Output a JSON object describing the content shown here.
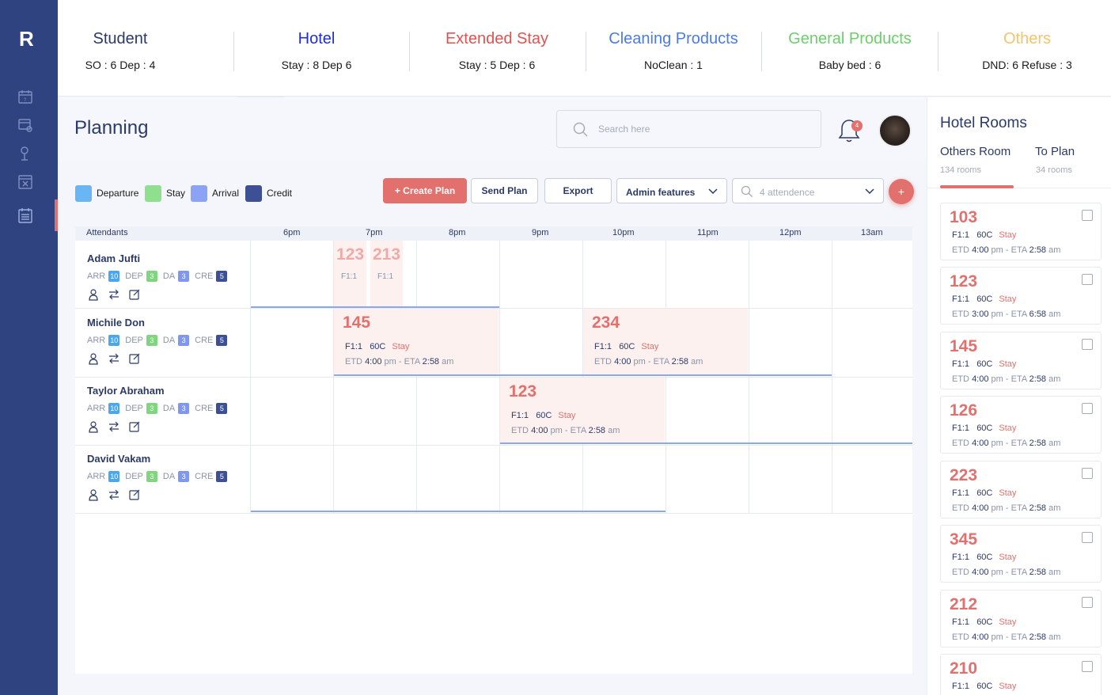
{
  "app": {
    "logo": "R"
  },
  "stats": [
    {
      "title": "Student",
      "sub": "SO : 6 Dep : 4",
      "color": "#2b3a67"
    },
    {
      "title": "Hotel",
      "sub": "Stay : 8 Dep 6",
      "color": "#1f2ddb"
    },
    {
      "title": "Extended Stay",
      "sub": "Stay : 5 Dep : 6",
      "color": "#e2524f"
    },
    {
      "title": "Cleaning Products",
      "sub": "NoClean : 1",
      "color": "#4b7be5"
    },
    {
      "title": "General Products",
      "sub": "Baby bed : 6",
      "color": "#6bcf6b"
    },
    {
      "title": "Others",
      "sub": "DND: 6 Refuse : 3",
      "color": "#f4c46a"
    }
  ],
  "header": {
    "title": "Planning",
    "search_placeholder": "Search here",
    "notifications": "4"
  },
  "legend": [
    {
      "label": "Departure",
      "color": "#6ab6f5"
    },
    {
      "label": "Stay",
      "color": "#8ee08e"
    },
    {
      "label": "Arrival",
      "color": "#8aa3f5"
    },
    {
      "label": "Credit",
      "color": "#3d4f95"
    }
  ],
  "toolbar": {
    "create": "+ Create Plan",
    "send": "Send Plan",
    "export": "Export",
    "admin": "Admin features",
    "attendance": "4 attendence",
    "add": "+"
  },
  "schedule": {
    "attendants_label": "Attendants",
    "times": [
      "6pm",
      "7pm",
      "8pm",
      "9pm",
      "10pm",
      "11pm",
      "12pm",
      "13am"
    ],
    "tag_labels": {
      "arr": "ARR",
      "dep": "DEP",
      "da": "DA",
      "cre": "CRE"
    },
    "tag_colors": {
      "arr": "#4aa6f0",
      "dep": "#7fd67f",
      "da": "#7f97f0",
      "cre": "#3d4f95"
    },
    "attendants": [
      {
        "name": "Adam Jufti",
        "arr": "10",
        "dep": "3",
        "da": "3",
        "cre": "5"
      },
      {
        "name": "Michile Don",
        "arr": "10",
        "dep": "3",
        "da": "3",
        "cre": "5"
      },
      {
        "name": "Taylor Abraham",
        "arr": "10",
        "dep": "3",
        "da": "3",
        "cre": "5"
      },
      {
        "name": "David Vakam",
        "arr": "10",
        "dep": "3",
        "da": "3",
        "cre": "5"
      }
    ],
    "mini_bookings": [
      {
        "room": "123",
        "floor": "F1:1"
      },
      {
        "room": "213",
        "floor": "F1:1"
      }
    ],
    "bookings": [
      {
        "room": "145",
        "floor": "F1:1",
        "temp": "60C",
        "status": "Stay",
        "etd_label": "ETD",
        "etd": "4:00",
        "etd_suffix": "pm - ETA",
        "eta": "2:58",
        "eta_suffix": "am"
      },
      {
        "room": "234",
        "floor": "F1:1",
        "temp": "60C",
        "status": "Stay",
        "etd_label": "ETD",
        "etd": "4:00",
        "etd_suffix": "pm - ETA",
        "eta": "2:58",
        "eta_suffix": "am"
      },
      {
        "room": "123",
        "floor": "F1:1",
        "temp": "60C",
        "status": "Stay",
        "etd_label": "ETD",
        "etd": "4:00",
        "etd_suffix": "pm - ETA",
        "eta": "2:58",
        "eta_suffix": "am"
      }
    ]
  },
  "rooms_panel": {
    "title": "Hotel Rooms",
    "tabs": [
      {
        "label": "Others Room",
        "sub": "134 rooms"
      },
      {
        "label": "To Plan",
        "sub": "34 rooms"
      }
    ],
    "rooms": [
      {
        "room": "103",
        "floor": "F1:1",
        "temp": "60C",
        "status": "Stay",
        "etd_label": "ETD",
        "etd": "4:00",
        "etd_suffix": "pm - ETA",
        "eta": "2:58",
        "eta_suffix": "am"
      },
      {
        "room": "123",
        "floor": "F1:1",
        "temp": "60C",
        "status": "Stay",
        "etd_label": "ETD",
        "etd": "3:00",
        "etd_suffix": "pm - ETA",
        "eta": "6:58",
        "eta_suffix": "am"
      },
      {
        "room": "145",
        "floor": "F1:1",
        "temp": "60C",
        "status": "Stay",
        "etd_label": "ETD",
        "etd": "4:00",
        "etd_suffix": "pm - ETA",
        "eta": "2:58",
        "eta_suffix": "am"
      },
      {
        "room": "126",
        "floor": "F1:1",
        "temp": "60C",
        "status": "Stay",
        "etd_label": "ETD",
        "etd": "4:00",
        "etd_suffix": "pm - ETA",
        "eta": "2:58",
        "eta_suffix": "am"
      },
      {
        "room": "223",
        "floor": "F1:1",
        "temp": "60C",
        "status": "Stay",
        "etd_label": "ETD",
        "etd": "4:00",
        "etd_suffix": "pm - ETA",
        "eta": "2:58",
        "eta_suffix": "am"
      },
      {
        "room": "345",
        "floor": "F1:1",
        "temp": "60C",
        "status": "Stay",
        "etd_label": "ETD",
        "etd": "4:00",
        "etd_suffix": "pm - ETA",
        "eta": "2:58",
        "eta_suffix": "am"
      },
      {
        "room": "212",
        "floor": "F1:1",
        "temp": "60C",
        "status": "Stay",
        "etd_label": "ETD",
        "etd": "4:00",
        "etd_suffix": "pm - ETA",
        "eta": "2:58",
        "eta_suffix": "am"
      },
      {
        "room": "210",
        "floor": "F1:1",
        "temp": "60C",
        "status": "Stay"
      }
    ]
  }
}
